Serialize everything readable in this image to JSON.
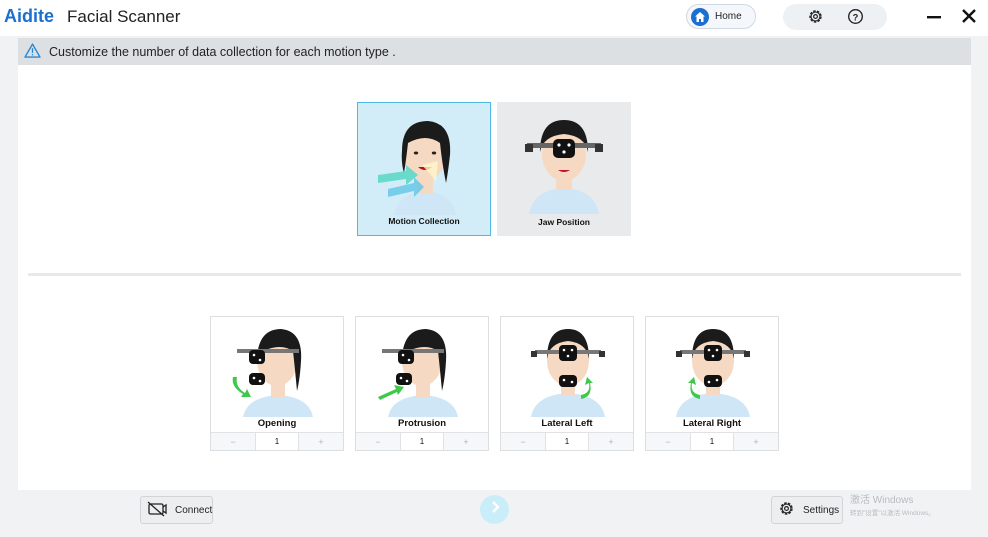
{
  "app": {
    "brand": "Aidite",
    "title": "Facial Scanner"
  },
  "header": {
    "home_label": "Home"
  },
  "icons": {
    "home": "home-icon",
    "settings": "gear-icon",
    "help": "help-icon",
    "minimize": "minimize-icon",
    "close": "close-icon",
    "warning": "warning-icon",
    "connect": "camera-off-icon",
    "next": "chevron-right-icon"
  },
  "colors": {
    "brand": "#1a6fd1",
    "accent": "#4fb8e3",
    "selected_bg": "#d3edf8",
    "arrow_green": "#3fc84a"
  },
  "notice": {
    "text": "Customize the number of data collection for each motion type ."
  },
  "collection_types": [
    {
      "label": "Motion Collection",
      "selected": true
    },
    {
      "label": "Jaw Position",
      "selected": false
    }
  ],
  "motions": [
    {
      "label": "Opening",
      "count": "1",
      "minus": "−",
      "plus": "+"
    },
    {
      "label": "Protrusion",
      "count": "1",
      "minus": "−",
      "plus": "+"
    },
    {
      "label": "Lateral Left",
      "count": "1",
      "minus": "−",
      "plus": "+"
    },
    {
      "label": "Lateral Right",
      "count": "1",
      "minus": "−",
      "plus": "+"
    }
  ],
  "footer": {
    "connect_label": "Connect",
    "settings_label": "Settings",
    "watermark_line1": "激活 Windows",
    "watermark_line2": "转到\"设置\"以激活 Windows。"
  }
}
